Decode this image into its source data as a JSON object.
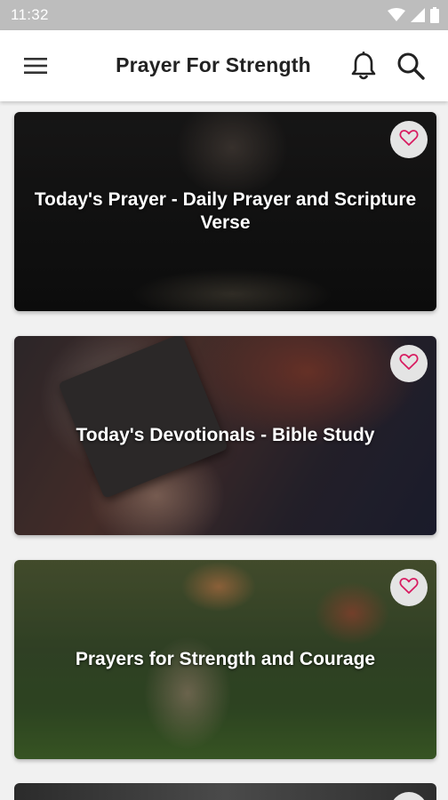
{
  "status_bar": {
    "time": "11:32",
    "icons": [
      "wifi-icon",
      "cellular-signal-icon",
      "battery-icon"
    ]
  },
  "app_bar": {
    "title": "Prayer For Strength",
    "menu_icon": "menu-icon",
    "notification_icon": "bell-icon",
    "search_icon": "search-icon"
  },
  "cards": [
    {
      "title": "Today's Prayer - Daily Prayer and Scripture Verse",
      "favorite_icon": "heart-outline-icon"
    },
    {
      "title": "Today's Devotionals - Bible Study",
      "favorite_icon": "heart-outline-icon"
    },
    {
      "title": "Prayers for Strength and Courage",
      "favorite_icon": "heart-outline-icon"
    }
  ],
  "colors": {
    "status_bar": "#bdbdbd",
    "app_bar": "#ffffff",
    "list_background": "#f1f1f1",
    "heart": "#d81b60",
    "favorite_button_bg": "#e4e4e4"
  }
}
